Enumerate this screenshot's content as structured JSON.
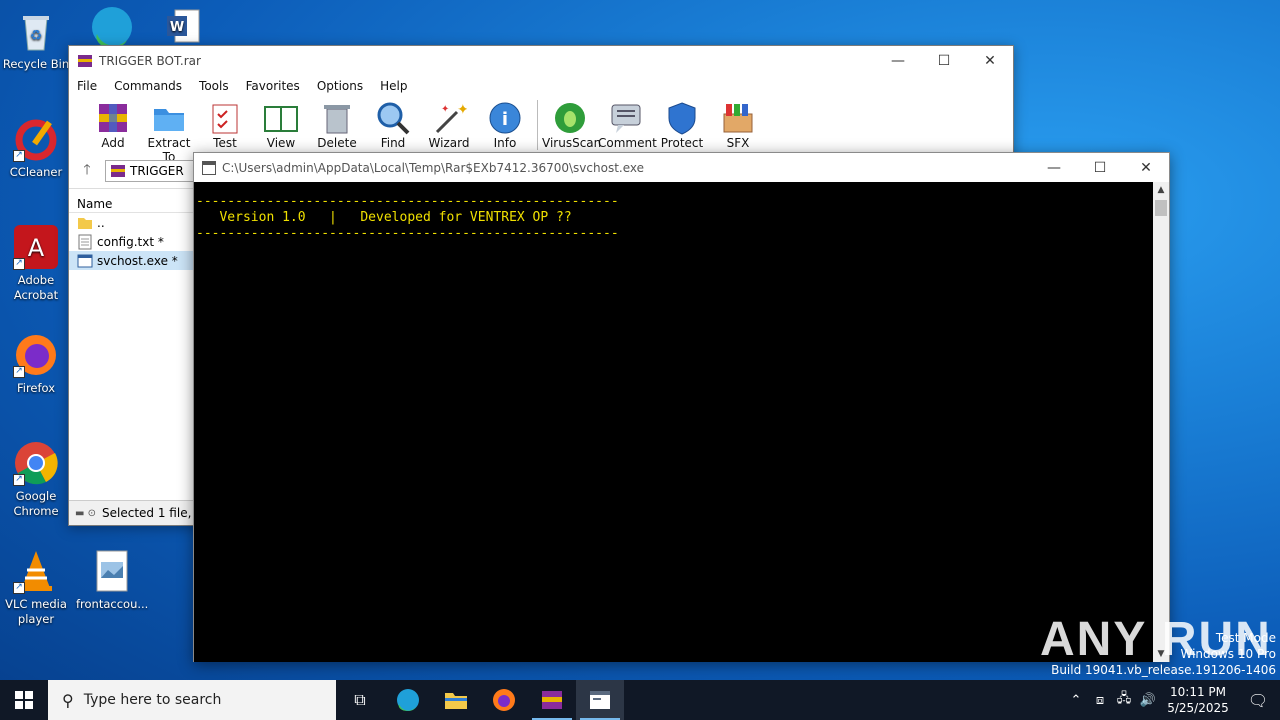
{
  "desktop_icons": [
    {
      "label": "Recycle Bin",
      "icon": "recycle-bin-icon"
    },
    {
      "label": "CCleaner",
      "icon": "ccleaner-icon"
    },
    {
      "label": "Adobe Acrobat",
      "icon": "adobe-acrobat-icon"
    },
    {
      "label": "Firefox",
      "icon": "firefox-icon"
    },
    {
      "label": "Google Chrome",
      "icon": "chrome-icon"
    },
    {
      "label": "VLC media player",
      "icon": "vlc-icon"
    },
    {
      "label": "frontaccou...",
      "icon": "image-file-icon"
    }
  ],
  "winrar": {
    "title": "TRIGGER BOT.rar",
    "menu": [
      "File",
      "Commands",
      "Tools",
      "Favorites",
      "Options",
      "Help"
    ],
    "toolbar": [
      "Add",
      "Extract To",
      "Test",
      "View",
      "Delete",
      "Find",
      "Wizard",
      "Info",
      "VirusScan",
      "Comment",
      "Protect",
      "SFX"
    ],
    "address": "TRIGGER",
    "column_name": "Name",
    "files": [
      {
        "name": ".."
      },
      {
        "name": "config.txt *"
      },
      {
        "name": "svchost.exe *"
      }
    ],
    "status": "Selected 1 file,"
  },
  "console": {
    "title": "C:\\Users\\admin\\AppData\\Local\\Temp\\Rar$EXb7412.36700\\svchost.exe",
    "lines": [
      "------------------------------------------------------",
      "   Version 1.0   |   Developed for VENTREX OP ??",
      "------------------------------------------------------"
    ]
  },
  "taskbar": {
    "search_placeholder": "Type here to search",
    "time": "10:11 PM",
    "date": "5/25/2025"
  },
  "watermark": {
    "line1": "Test Mode",
    "line2": "Windows 10 Pro",
    "line3": "Build 19041.vb_release.191206-1406",
    "brand": "ANY RUN"
  },
  "colors": {
    "console_text": "#f0e000",
    "console_bg": "#000000",
    "desktop": "#0c5cb8",
    "taskbar": "#101826"
  }
}
